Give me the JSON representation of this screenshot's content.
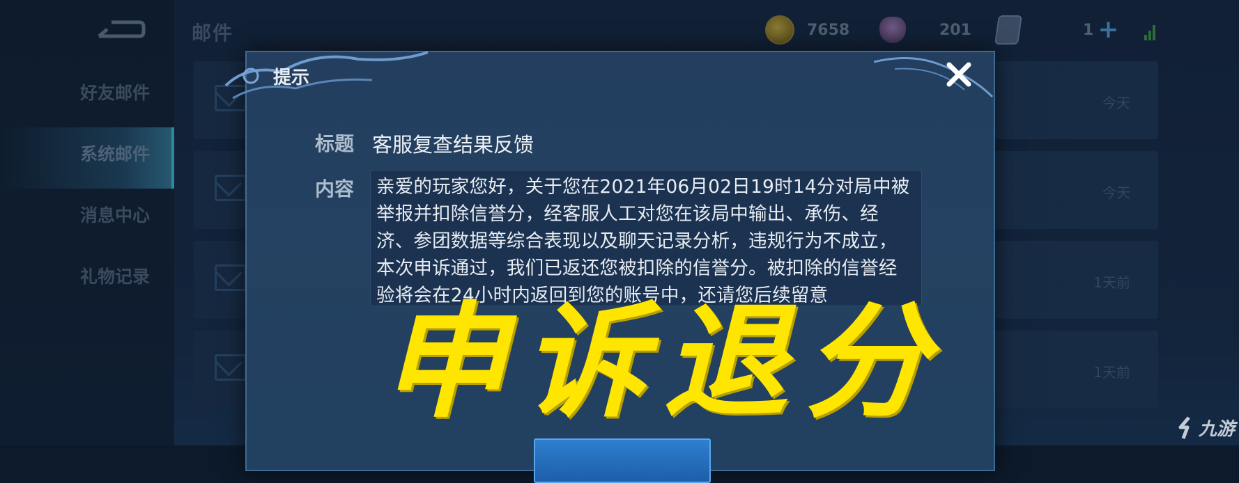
{
  "header": {
    "title": "邮件",
    "currencies": [
      {
        "icon": "gold-coin-icon",
        "value": "7658"
      },
      {
        "icon": "gem-icon",
        "value": "201"
      },
      {
        "icon": "card-icon",
        "value": "1"
      }
    ]
  },
  "sidebar": {
    "items": [
      {
        "label": "好友邮件",
        "active": false
      },
      {
        "label": "系统邮件",
        "active": true
      },
      {
        "label": "消息中心",
        "active": false
      },
      {
        "label": "礼物记录",
        "active": false
      }
    ]
  },
  "mail_list": {
    "rows": [
      {
        "time": "今天"
      },
      {
        "time": "今天"
      },
      {
        "time": "1天前"
      },
      {
        "time": "1天前"
      }
    ]
  },
  "dialog": {
    "title": "提示",
    "subject_label": "标题",
    "subject": "客服复查结果反馈",
    "content_label": "内容",
    "content": "亲爱的玩家您好，关于您在2021年06月02日19时14分对局中被举报并扣除信誉分，经客服人工对您在该局中输出、承伤、经济、参团数据等综合表现以及聊天记录分析，违规行为不成立，本次申诉通过，我们已返还您被扣除的信誉分。被扣除的信誉经验将会在24小时内返回到您的账号中，还请您后续留意"
  },
  "overlay": {
    "caption": "申诉退分"
  },
  "watermark": {
    "text": "九游"
  },
  "colors": {
    "overlay_text": "#ffe600",
    "dialog_bg": "#233e5e",
    "dialog_border": "#3f6a93"
  }
}
